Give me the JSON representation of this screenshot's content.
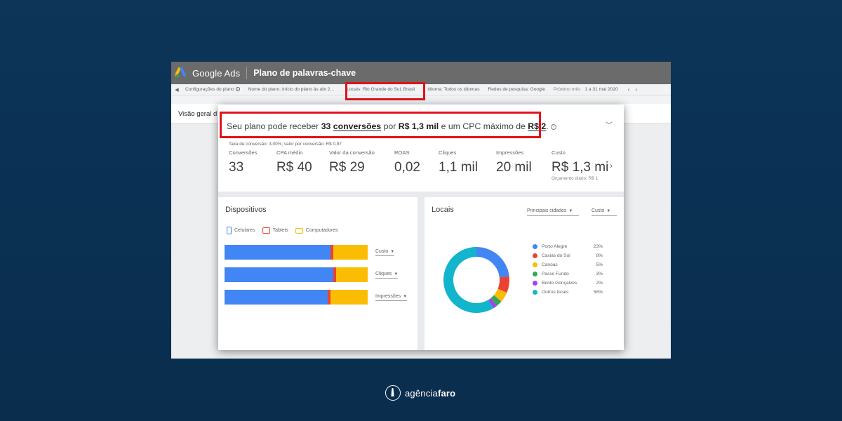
{
  "app": {
    "brand": "Google Ads",
    "title": "Plano de palavras-chave"
  },
  "settings_bar": {
    "items": [
      {
        "label": "Configurações do plano"
      },
      {
        "label": "Nome do plano: Início do plano às abr 2..."
      },
      {
        "label": "Locais: Rio Grande do Sul, Brasil"
      },
      {
        "label": "Idioma: Todos os idiomas"
      },
      {
        "label": "Redes de pesquisa: Google"
      }
    ],
    "period_label": "Próximo mês",
    "period_value": "1 a 31 mai 2020"
  },
  "overview": {
    "title": "Visão geral d"
  },
  "summary": {
    "headline_pre": "Seu plano pode receber ",
    "headline_conv_num": "33",
    "headline_conv_word": "conversões",
    "headline_mid": " por ",
    "headline_cost": "R$ 1,3 mil",
    "headline_mid2": " e um CPC máximo de ",
    "headline_cpc": "R$ 2",
    "headline_end": ".",
    "conversion_rate_note": "Taxa de conversão: 3,00%; valor por conversão: R$ 0,87",
    "metrics": [
      {
        "label": "Conversões",
        "value": "33"
      },
      {
        "label": "CPA médio",
        "value": "R$ 40"
      },
      {
        "label": "Valor da conversão",
        "value": "R$ 29"
      },
      {
        "label": "ROAS",
        "value": "0,02"
      },
      {
        "label": "Cliques",
        "value": "1,1 mil"
      },
      {
        "label": "Impressões",
        "value": "20 mil"
      },
      {
        "label": "Custo",
        "value": "R$ 1,3 mil",
        "sub": "Orçamento diário: R$ 1"
      }
    ]
  },
  "devices": {
    "title": "Dispositivos",
    "legend": [
      {
        "name": "Celulares",
        "color": "#4285f4"
      },
      {
        "name": "Tablets",
        "color": "#ea4335"
      },
      {
        "name": "Computadores",
        "color": "#fbbc04"
      }
    ],
    "rows": [
      {
        "metric": "Custo",
        "shares": [
          0.74,
          0.02,
          0.24
        ]
      },
      {
        "metric": "Cliques",
        "shares": [
          0.76,
          0.02,
          0.22
        ]
      },
      {
        "metric": "Impressões",
        "shares": [
          0.72,
          0.02,
          0.26
        ]
      }
    ]
  },
  "locations": {
    "title": "Locais",
    "dimension_select": "Principais cidades",
    "metric_select": "Custo",
    "items": [
      {
        "name": "Porto Alegre",
        "pct": "23%",
        "value": 23,
        "color": "#4285f4"
      },
      {
        "name": "Caxias do Sul",
        "pct": "8%",
        "value": 8,
        "color": "#ea4335"
      },
      {
        "name": "Canoas",
        "pct": "5%",
        "value": 5,
        "color": "#fbbc04"
      },
      {
        "name": "Passo Fundo",
        "pct": "3%",
        "value": 3,
        "color": "#34a853"
      },
      {
        "name": "Bento Gonçalves",
        "pct": "2%",
        "value": 2,
        "color": "#a142f4"
      },
      {
        "name": "Outros locais",
        "pct": "58%",
        "value": 58,
        "color": "#12b5cb"
      }
    ]
  },
  "footer": {
    "brand_light": "agência",
    "brand_bold": "faro"
  }
}
